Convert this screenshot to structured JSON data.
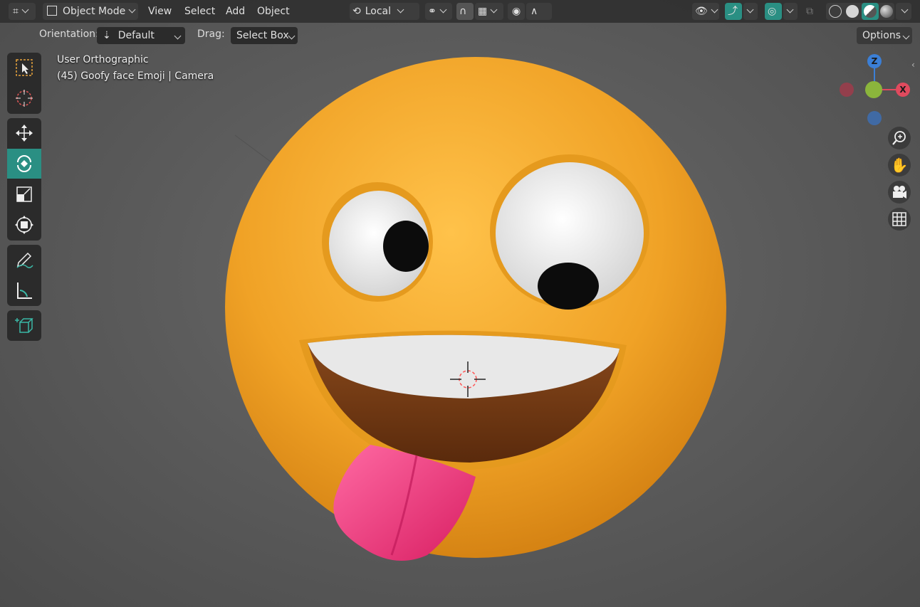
{
  "header": {
    "editor_type_icon": "object-mode-grid-icon",
    "mode": "Object Mode",
    "menus": [
      "View",
      "Select",
      "Add",
      "Object"
    ],
    "transform_orientation": "Local",
    "right_options": "Options"
  },
  "tool_settings": {
    "orientation_label": "Orientation:",
    "orientation_value": "Default",
    "drag_label": "Drag:",
    "drag_value": "Select Box"
  },
  "viewport": {
    "view_name": "User Orthographic",
    "object_info": "(45) Goofy face Emoji | Camera"
  },
  "gizmo": {
    "z_label": "Z",
    "x_label": "X"
  },
  "colors": {
    "accent": "#2a8f83",
    "face": "#f2a52a",
    "tongue": "#e83a7a",
    "axis_x": "#e04a5e",
    "axis_y": "#8bb53c",
    "axis_z": "#3b7fd6"
  }
}
